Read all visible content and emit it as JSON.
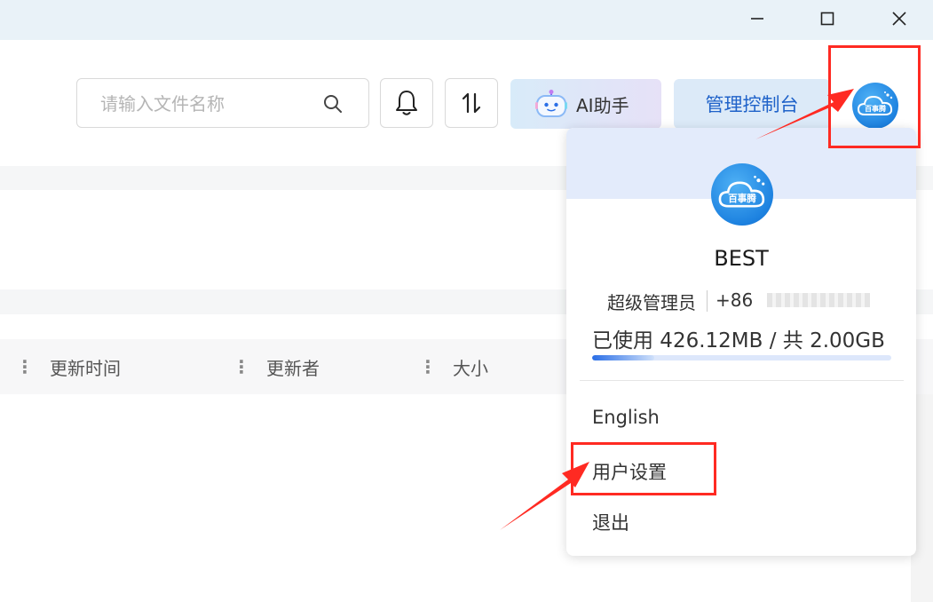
{
  "window": {
    "controls": [
      "minimize",
      "maximize",
      "close"
    ]
  },
  "toolbar": {
    "search": {
      "placeholder": "请输入文件名称",
      "icon": "search-icon"
    },
    "notification_icon": "bell-icon",
    "sort_icon": "sort-arrows-icon",
    "ai_button_label": "AI助手",
    "admin_button_label": "管理控制台",
    "avatar_text": "百事腾"
  },
  "table": {
    "columns": [
      "更新时间",
      "更新者",
      "大小"
    ]
  },
  "user_menu": {
    "name": "BEST",
    "role": "超级管理员",
    "phone_prefix": "+86",
    "usage_text": "已使用 426.12MB / 共 2.00GB",
    "usage_fraction": 0.208,
    "items": [
      "English",
      "用户设置",
      "退出"
    ]
  },
  "colors": {
    "accent": "#1f62c9",
    "annotation": "#ff2a22",
    "titlebar": "#e9f2f8"
  }
}
